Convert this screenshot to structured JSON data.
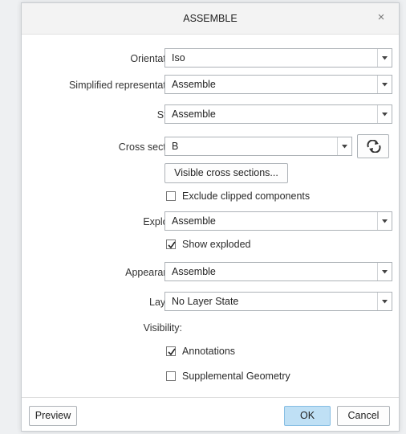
{
  "dialog": {
    "title": "ASSEMBLE",
    "close_icon": "×"
  },
  "form": {
    "orientation": {
      "label": "Orientation:",
      "value": "Iso"
    },
    "simplified_rep": {
      "label": "Simplified representation:",
      "value": "Assemble"
    },
    "style": {
      "label": "Style:",
      "value": "Assemble"
    },
    "cross_section": {
      "label": "Cross section:",
      "value": "B"
    },
    "visible_cross_sections_button": "Visible cross sections...",
    "exclude_clipped": {
      "label": "Exclude clipped components",
      "checked": false
    },
    "explode": {
      "label": "Explode:",
      "value": "Assemble"
    },
    "show_exploded": {
      "label": "Show exploded",
      "checked": true
    },
    "appearance": {
      "label": "Appearance:",
      "value": "Assemble"
    },
    "layers": {
      "label": "Layers:",
      "value": "No Layer State"
    },
    "visibility": {
      "label": "Visibility:"
    },
    "annotations": {
      "label": "Annotations",
      "checked": true
    },
    "supplemental_geometry": {
      "label": "Supplemental Geometry",
      "checked": false
    }
  },
  "footer": {
    "preview": "Preview",
    "ok": "OK",
    "cancel": "Cancel"
  },
  "icons": {
    "dropdown": "chevron-down-icon",
    "refresh": "refresh-icon",
    "check": "checkmark-icon"
  },
  "colors": {
    "ok_button": "#bfe0f5",
    "border": "#adb2b7"
  }
}
